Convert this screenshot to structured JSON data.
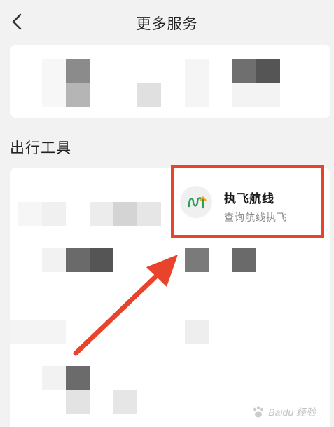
{
  "header": {
    "title": "更多服务",
    "back_icon": "chevron-left-icon"
  },
  "section": {
    "title": "出行工具"
  },
  "highlighted_service": {
    "name": "执飞航线",
    "description": "查询航线执飞",
    "icon": "flight-route-icon",
    "icon_colors": [
      "#2e9e5b",
      "#f5a623"
    ]
  },
  "annotation": {
    "box_color": "#e8432b",
    "arrow_color": "#e8432b"
  },
  "watermark": {
    "text": "Baidu 经验",
    "logo": "baidu-paw-icon"
  }
}
